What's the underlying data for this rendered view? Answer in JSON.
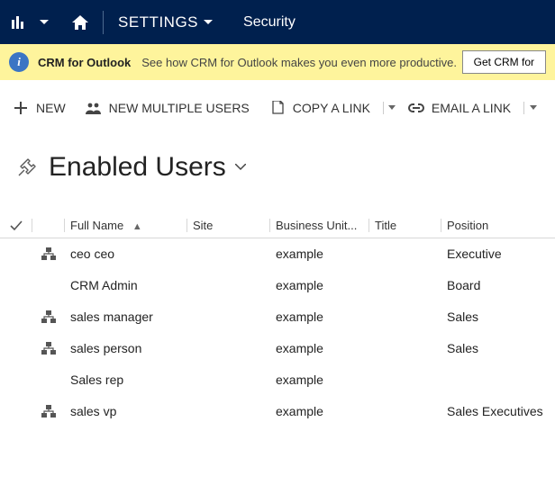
{
  "nav": {
    "settings_label": "SETTINGS",
    "page_label": "Security"
  },
  "banner": {
    "title": "CRM for Outlook",
    "text": "See how CRM for Outlook makes you even more productive.",
    "button": "Get CRM for"
  },
  "commands": {
    "new": "NEW",
    "new_multiple": "NEW MULTIPLE USERS",
    "copy_link": "COPY A LINK",
    "email_link": "EMAIL A LINK"
  },
  "view": {
    "title": "Enabled Users"
  },
  "columns": {
    "full_name": "Full Name",
    "site": "Site",
    "business_unit": "Business Unit...",
    "title": "Title",
    "position": "Position"
  },
  "rows": [
    {
      "icon": true,
      "full_name": "ceo ceo",
      "site": "",
      "business_unit": "example",
      "title": "",
      "position": "Executive"
    },
    {
      "icon": false,
      "full_name": "CRM Admin",
      "site": "",
      "business_unit": "example",
      "title": "",
      "position": "Board"
    },
    {
      "icon": true,
      "full_name": "sales manager",
      "site": "",
      "business_unit": "example",
      "title": "",
      "position": "Sales"
    },
    {
      "icon": true,
      "full_name": "sales person",
      "site": "",
      "business_unit": "example",
      "title": "",
      "position": "Sales"
    },
    {
      "icon": false,
      "full_name": "Sales rep",
      "site": "",
      "business_unit": "example",
      "title": "",
      "position": ""
    },
    {
      "icon": true,
      "full_name": "sales vp",
      "site": "",
      "business_unit": "example",
      "title": "",
      "position": "Sales Executives"
    }
  ]
}
